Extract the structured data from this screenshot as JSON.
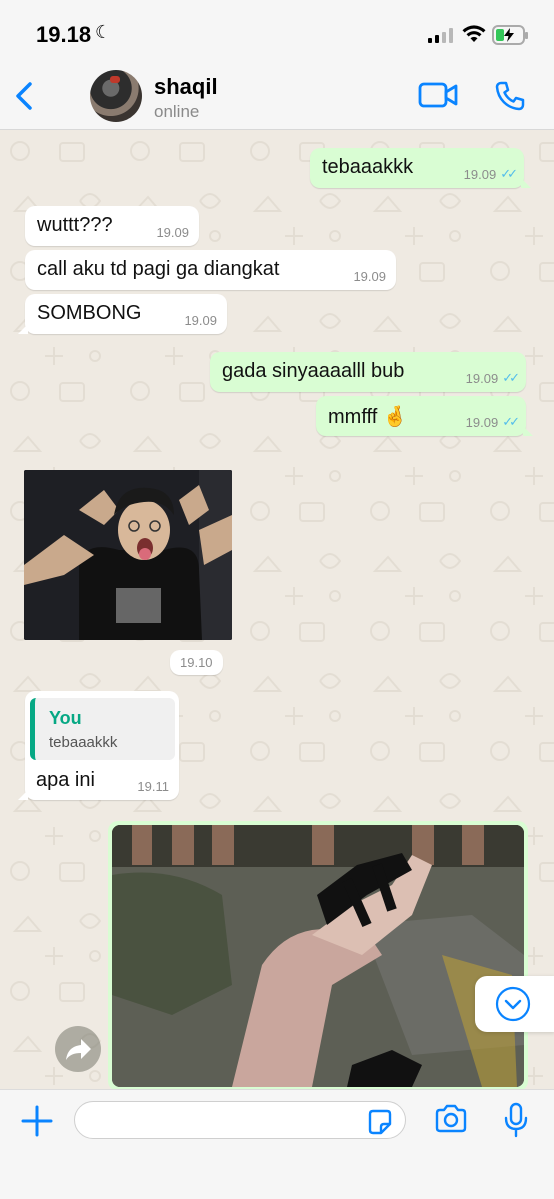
{
  "status_bar": {
    "time": "19.18",
    "moon": "☾"
  },
  "header": {
    "name": "shaqil",
    "status": "online"
  },
  "messages": [
    {
      "text": "tebaaakkk",
      "time": "19.09",
      "dir": "out"
    },
    {
      "text": "wuttt???",
      "time": "19.09",
      "dir": "in"
    },
    {
      "text": "call aku td pagi ga diangkat",
      "time": "19.09",
      "dir": "in"
    },
    {
      "text": "SOMBONG",
      "time": "19.09",
      "dir": "in"
    },
    {
      "text": "gada sinyaaaalll bub",
      "time": "19.09",
      "dir": "out"
    },
    {
      "text": "mmfff 🤞",
      "time": "19.09",
      "dir": "out"
    },
    {
      "time": "19.10",
      "dir": "in",
      "type": "image"
    },
    {
      "text": "apa ini",
      "time": "19.11",
      "dir": "in",
      "reply_to": {
        "author": "You",
        "text": "tebaaakkk"
      }
    }
  ],
  "composer": {
    "placeholder": ""
  },
  "colors": {
    "accent": "#0a84ff",
    "out_bubble": "#d9fdd3",
    "in_bubble": "#ffffff",
    "read_ticks": "#53bdeb",
    "reply_bar": "#06a884"
  },
  "icons": {
    "back": "chevron-left-icon",
    "video": "video-camera-icon",
    "call": "phone-icon",
    "plus": "plus-icon",
    "sticker": "sticker-icon",
    "camera": "camera-icon",
    "mic": "microphone-icon",
    "forward": "forward-icon",
    "scroll": "chevron-down-circle-icon"
  }
}
